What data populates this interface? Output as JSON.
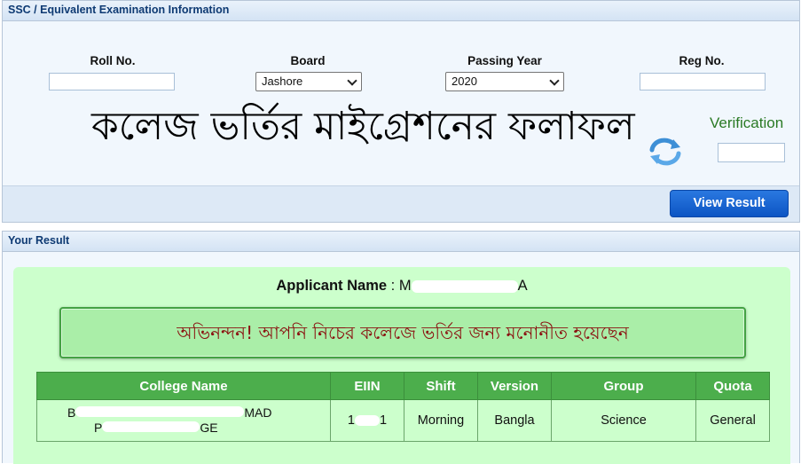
{
  "ssc_panel": {
    "title": "SSC / Equivalent Examination Information",
    "roll_label": "Roll No.",
    "roll_value": "...........ᐧ'ᐧ'ᐧ'",
    "board_label": "Board",
    "board_value": "Jashore",
    "year_label": "Passing Year",
    "year_value": "2020",
    "reg_label": "Reg No.",
    "reg_value": "",
    "overlay_title": "কলেজ ভর্তির মাইগ্রেশনের ফলাফল",
    "verification_label": "Verification",
    "verification_value": "",
    "view_button": "View Result"
  },
  "result_panel": {
    "title": "Your Result",
    "applicant_label": "Applicant Name",
    "applicant_sep": " : ",
    "applicant_value_visible_start": "M",
    "applicant_value_visible_end": "A",
    "congrats_text": "অভিনন্দন! আপনি নিচের কলেজে ভর্তির জন্য মনোনীত হয়েছেন",
    "table": {
      "headers": [
        "College Name",
        "EIIN",
        "Shift",
        "Version",
        "Group",
        "Quota"
      ],
      "row": {
        "college_line1_start": "B",
        "college_line1_end": "MAD",
        "college_line2_start": "P",
        "college_line2_end": "GE",
        "eiin_start": "1",
        "eiin_end": "1",
        "shift": "Morning",
        "version": "Bangla",
        "group": "Science",
        "quota": "General"
      }
    }
  },
  "colors": {
    "panel_title": "#0e3a73",
    "verification": "#2a7a24",
    "button": "#0c55c4",
    "result_bg": "#ccffcc",
    "table_header": "#4cae4c",
    "congrats_text": "#8a1010"
  }
}
